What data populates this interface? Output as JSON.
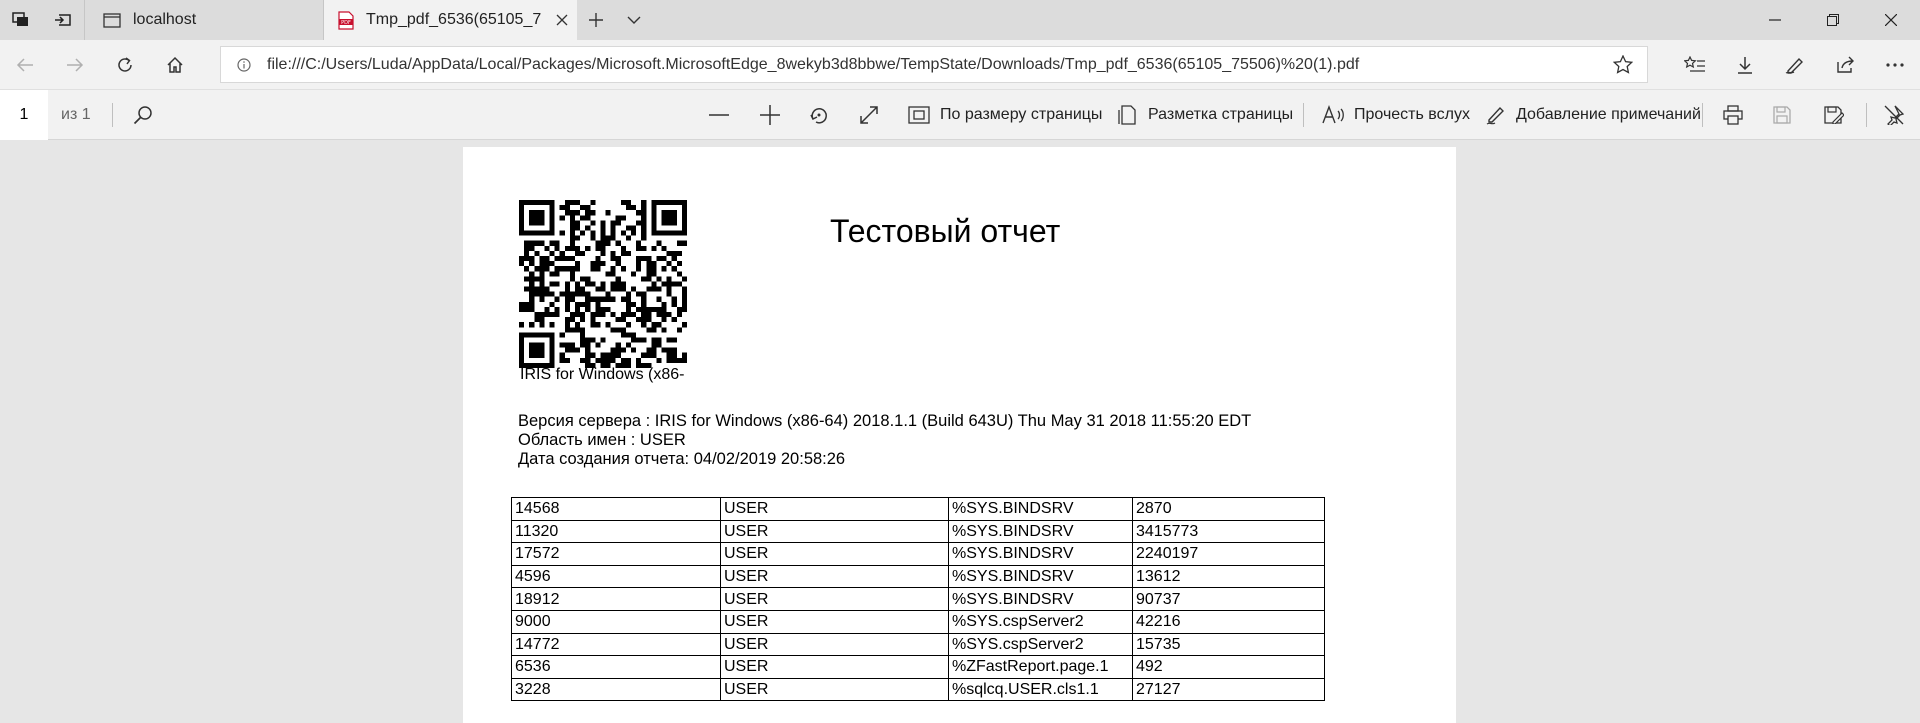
{
  "browser": {
    "tabs": [
      {
        "title": "localhost",
        "active": false
      },
      {
        "title": "Tmp_pdf_6536(65105_7",
        "active": true
      }
    ],
    "address": "file:///C:/Users/Luda/AppData/Local/Packages/Microsoft.MicrosoftEdge_8wekyb3d8bbwe/TempState/Downloads/Tmp_pdf_6536(65105_75506)%20(1).pdf"
  },
  "pdf_toolbar": {
    "page_number": "1",
    "page_count": "из 1",
    "fit_page": "По размеру страницы",
    "page_layout": "Разметка страницы",
    "read_aloud": "Прочесть вслух",
    "add_notes": "Добавление примечаний"
  },
  "document": {
    "title": "Тестовый отчет",
    "qr_caption": "IRIS for Windows (x86-",
    "server_version": "Версия сервера : IRIS for Windows (x86-64) 2018.1.1 (Build 643U) Thu May 31 2018 11:55:20 EDT",
    "namespace": "Область имен : USER",
    "created": "Дата создания отчета: 04/02/2019 20:58:26",
    "rows": [
      [
        "14568",
        "USER",
        "%SYS.BINDSRV",
        "2870"
      ],
      [
        "11320",
        "USER",
        "%SYS.BINDSRV",
        "3415773"
      ],
      [
        "17572",
        "USER",
        "%SYS.BINDSRV",
        "2240197"
      ],
      [
        "4596",
        "USER",
        "%SYS.BINDSRV",
        "13612"
      ],
      [
        "18912",
        "USER",
        "%SYS.BINDSRV",
        "90737"
      ],
      [
        "9000",
        "USER",
        "%SYS.cspServer2",
        "42216"
      ],
      [
        "14772",
        "USER",
        "%SYS.cspServer2",
        "15735"
      ],
      [
        "6536",
        "USER",
        "%ZFastReport.page.1",
        "492"
      ],
      [
        "3228",
        "USER",
        "%sqlcq.USER.cls1.1",
        "27127"
      ]
    ]
  }
}
